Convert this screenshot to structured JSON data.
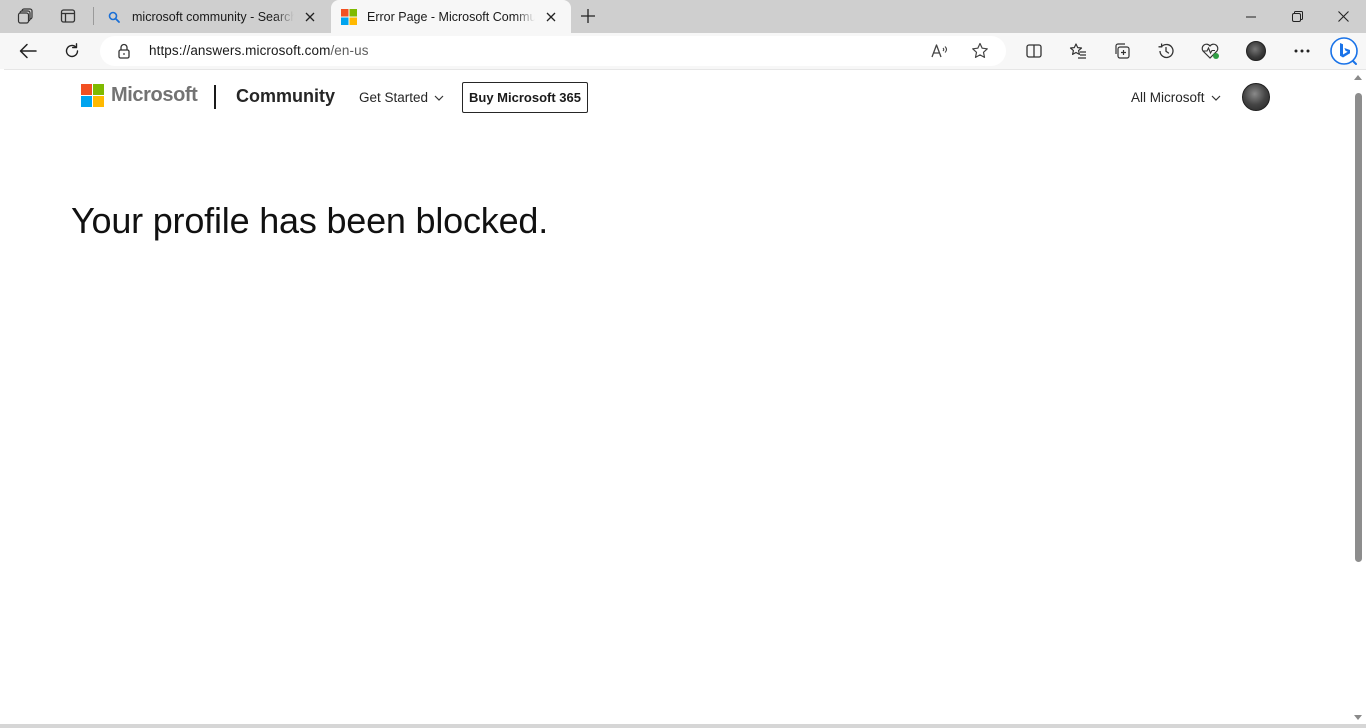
{
  "browser": {
    "tabs": [
      {
        "title": "microsoft community - Search",
        "favicon": "search-icon",
        "active": false
      },
      {
        "title": "Error Page - Microsoft Community",
        "favicon": "microsoft-logo-icon",
        "active": true
      }
    ],
    "address_bar": {
      "url_host": "https://answers.microsoft.com",
      "url_path": "/en-us"
    }
  },
  "site": {
    "brand": "Microsoft",
    "section": "Community",
    "nav": {
      "get_started": "Get Started",
      "buy_button": "Buy Microsoft 365",
      "all_microsoft": "All Microsoft"
    },
    "colors": {
      "logo_red": "#f25022",
      "logo_green": "#7fba00",
      "logo_blue": "#00a4ef",
      "logo_yellow": "#ffb900"
    }
  },
  "main": {
    "headline": "Your profile has been blocked."
  }
}
